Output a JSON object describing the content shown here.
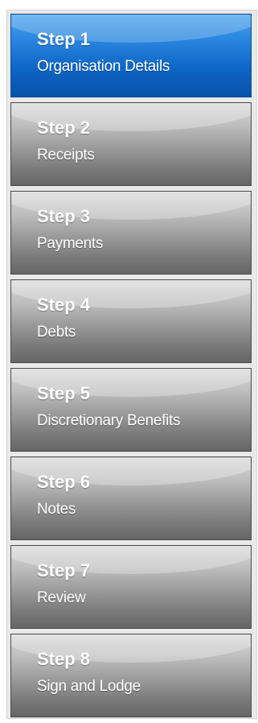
{
  "steps": [
    {
      "step": "Step 1",
      "title": "Organisation Details",
      "active": true
    },
    {
      "step": "Step 2",
      "title": "Receipts",
      "active": false
    },
    {
      "step": "Step 3",
      "title": "Payments",
      "active": false
    },
    {
      "step": "Step 4",
      "title": "Debts",
      "active": false
    },
    {
      "step": "Step 5",
      "title": "Discretionary Benefits",
      "active": false
    },
    {
      "step": "Step 6",
      "title": "Notes",
      "active": false
    },
    {
      "step": "Step 7",
      "title": "Review",
      "active": false
    },
    {
      "step": "Step 8",
      "title": "Sign and Lodge",
      "active": false
    }
  ],
  "colors": {
    "active": "#0e66c7",
    "inactive": "#9a9a9a"
  }
}
